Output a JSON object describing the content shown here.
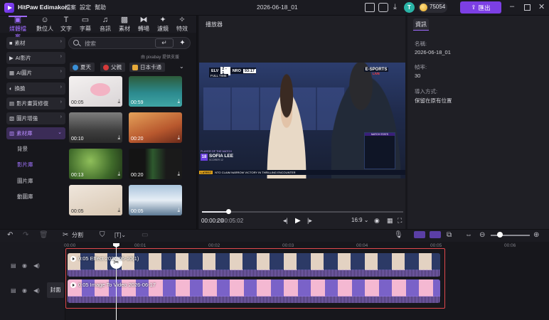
{
  "app": {
    "title": "HitPaw Edimakor",
    "menus": [
      "檔案",
      "設定",
      "幫助"
    ],
    "project": "2026-06-18_01",
    "avatar_letter": "T",
    "coins": "75054",
    "export_label": "匯出"
  },
  "left_tabs": [
    {
      "label": "媒體檔案",
      "icon": "folder-icon"
    },
    {
      "label": "數位人",
      "icon": "avatar-icon"
    },
    {
      "label": "文字",
      "icon": "text-icon"
    },
    {
      "label": "字幕",
      "icon": "subtitle-icon"
    },
    {
      "label": "音訊",
      "icon": "music-icon"
    },
    {
      "label": "素材",
      "icon": "sticker-icon"
    },
    {
      "label": "轉場",
      "icon": "transition-icon"
    },
    {
      "label": "濾鏡",
      "icon": "filter-icon"
    },
    {
      "label": "特效",
      "icon": "effect-icon"
    }
  ],
  "categories": [
    {
      "label": "素材",
      "icon": "folder-icon"
    },
    {
      "label": "AI影片",
      "icon": "ai-video-icon"
    },
    {
      "label": "AI圖片",
      "icon": "ai-image-icon"
    },
    {
      "label": "換臉",
      "icon": "face-swap-icon"
    },
    {
      "label": "影片畫質修復",
      "icon": "repair-icon"
    },
    {
      "label": "圖片增強",
      "icon": "enhance-icon"
    },
    {
      "label": "素材庫",
      "icon": "library-icon"
    }
  ],
  "sub_categories": [
    "背景",
    "影片庫",
    "圖片庫",
    "動圖庫"
  ],
  "search": {
    "placeholder": "搜索",
    "powered_by": "由 pixabay 提供支援"
  },
  "chips": [
    {
      "label": "夏天",
      "color": "#3a8fd6"
    },
    {
      "label": "父親",
      "color": "#d63a3a"
    },
    {
      "label": "日本卡通",
      "color": "#e6a93a"
    }
  ],
  "media": [
    {
      "duration": "00:05"
    },
    {
      "duration": "00:59"
    },
    {
      "duration": "00:10"
    },
    {
      "duration": "00:20"
    },
    {
      "duration": "00:13"
    },
    {
      "duration": "00:20"
    },
    {
      "duration": "00:05"
    },
    {
      "duration": "00:05"
    }
  ],
  "player": {
    "title": "播放器",
    "current": "00:00:20",
    "total": "00:05:02",
    "aspect": "16:9",
    "progress": 0.13,
    "scoreboard": {
      "team1": "ELV",
      "score": "2 - 1",
      "team2": "NRO",
      "clock": "93:17",
      "status": "FULL TIME",
      "brand": "E-SPORTS",
      "live": "LIVE",
      "player_role": "PLAYER OF THE MATCH",
      "player_num": "18",
      "player_name": "SOFIA LEE",
      "player_sub": "SCORER 12",
      "ticker_tag": "LATEST",
      "ticker": "NTO CLAIM NARROW VICTORY IN THRILLING ENCOUNTER",
      "stats_title": "MATCH STATS"
    }
  },
  "info": {
    "tab": "資訊",
    "name_label": "名稱:",
    "name_value": "2026-06-18_01",
    "fps_label": "幀率:",
    "fps_value": "30",
    "import_label": "導入方式:",
    "import_value": "保留在原有位置"
  },
  "toolbar": {
    "split_label": "分割"
  },
  "timeline": {
    "ruler": [
      "00:00",
      "00:01",
      "00:02",
      "00:03",
      "00:04",
      "00:05",
      "00:06"
    ],
    "cover_label": "封面",
    "clips": [
      {
        "label": "0:05  Effect 2026-06-10(1)"
      },
      {
        "label": "0:05  Image To Video 2026-06-17"
      }
    ]
  }
}
